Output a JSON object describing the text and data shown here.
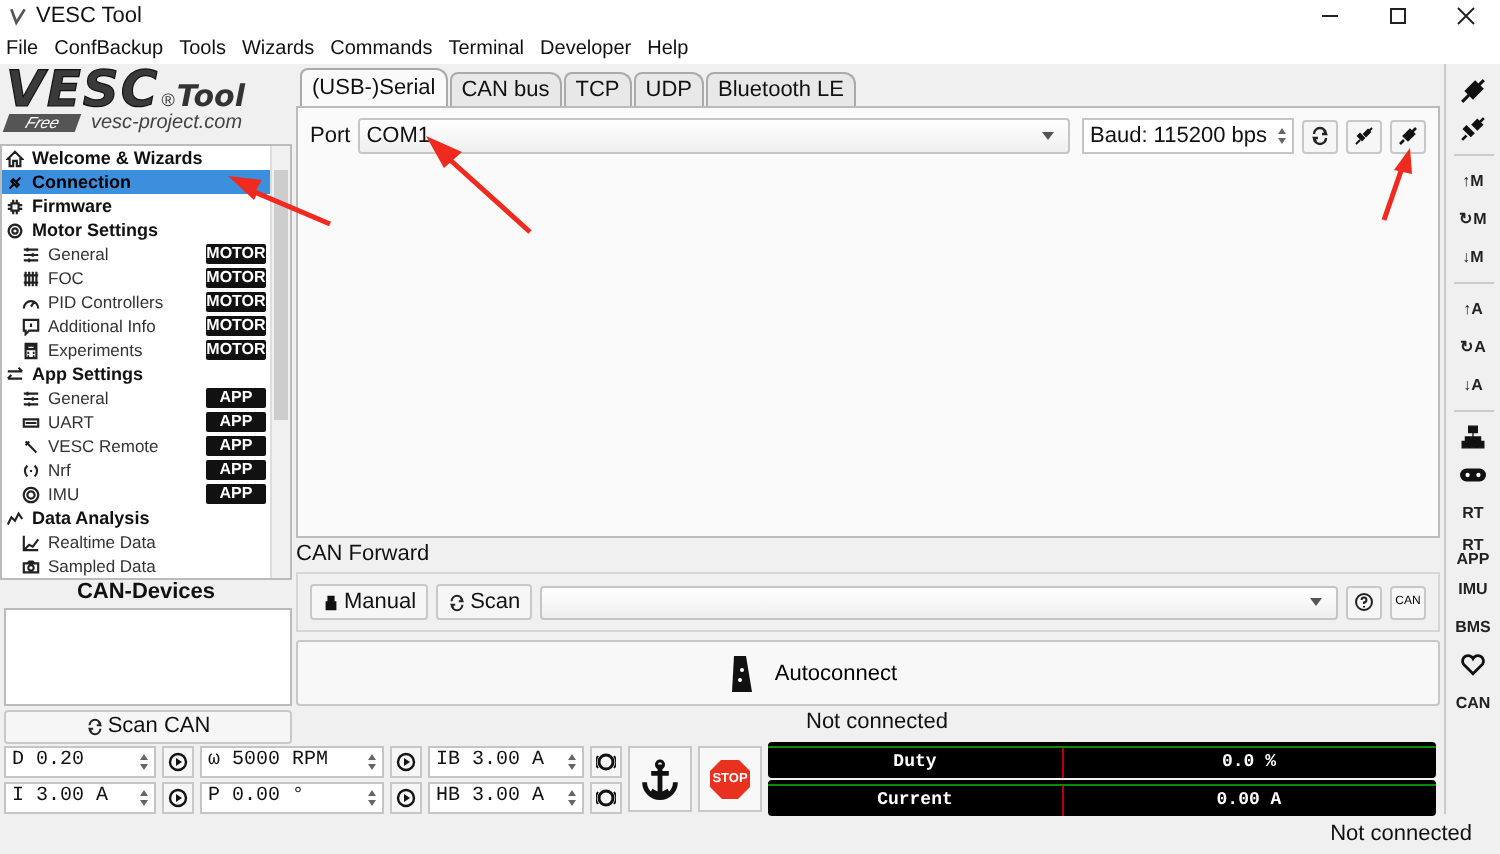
{
  "window": {
    "title": "VESC Tool"
  },
  "menu": [
    "File",
    "ConfBackup",
    "Tools",
    "Wizards",
    "Commands",
    "Terminal",
    "Developer",
    "Help"
  ],
  "logo": {
    "name": "VESC",
    "mark": "®",
    "product": "Tool",
    "edition": "Free",
    "url": "vesc-project.com"
  },
  "sidebar": {
    "items": [
      {
        "label": "Welcome & Wizards",
        "selected": false
      },
      {
        "label": "Connection",
        "selected": true
      },
      {
        "label": "Firmware",
        "selected": false
      },
      {
        "label": "Motor Settings",
        "selected": false,
        "children": [
          {
            "label": "General",
            "badge": "MOTOR",
            "selected": false
          },
          {
            "label": "FOC",
            "badge": "MOTOR",
            "selected": false
          },
          {
            "label": "PID Controllers",
            "badge": "MOTOR",
            "selected": false
          },
          {
            "label": "Additional Info",
            "badge": "MOTOR",
            "selected": false
          },
          {
            "label": "Experiments",
            "badge": "MOTOR",
            "selected": false
          }
        ]
      },
      {
        "label": "App Settings",
        "selected": false,
        "children": [
          {
            "label": "General",
            "badge": "APP",
            "selected": false
          },
          {
            "label": "UART",
            "badge": "APP",
            "selected": false
          },
          {
            "label": "VESC Remote",
            "badge": "APP",
            "selected": false
          },
          {
            "label": "Nrf",
            "badge": "APP",
            "selected": false
          },
          {
            "label": "IMU",
            "badge": "APP",
            "selected": false
          }
        ]
      },
      {
        "label": "Data Analysis",
        "selected": false,
        "children": [
          {
            "label": "Realtime Data",
            "selected": false
          },
          {
            "label": "Sampled Data",
            "selected": false
          }
        ]
      }
    ]
  },
  "can_devices": {
    "title": "CAN-Devices",
    "scan_button": "Scan CAN"
  },
  "tabs": [
    {
      "label": "(USB-)Serial",
      "selected": true
    },
    {
      "label": "CAN bus",
      "selected": false
    },
    {
      "label": "TCP",
      "selected": false
    },
    {
      "label": "UDP",
      "selected": false
    },
    {
      "label": "Bluetooth LE",
      "selected": false
    }
  ],
  "port": {
    "label": "Port",
    "value": "COM1",
    "baud": "Baud: 115200 bps"
  },
  "can_forward": {
    "title": "CAN Forward",
    "manual_button": "Manual",
    "scan_button": "Scan",
    "can_button": "CAN"
  },
  "autoconnect_button": "Autoconnect",
  "connection_status": "Not connected",
  "controls": [
    {
      "value": "D 0.20",
      "kind": "play"
    },
    {
      "value": "ω 5000 RPM",
      "kind": "play"
    },
    {
      "value": "IB 3.00 A",
      "kind": "brake"
    },
    {
      "value": "I 3.00 A",
      "kind": "play"
    },
    {
      "value": "P 0.00 °",
      "kind": "play"
    },
    {
      "value": "HB 3.00 A",
      "kind": "brake"
    }
  ],
  "stop_button": "STOP",
  "gauges": [
    {
      "label": "Duty",
      "reading": "0.0 %"
    },
    {
      "label": "Current",
      "reading": "0.00 A"
    }
  ],
  "toolbar": [
    [
      {
        "kind": "connect"
      },
      {
        "kind": "disconnect"
      }
    ],
    [
      {
        "kind": "text",
        "label": "↑M"
      },
      {
        "kind": "text",
        "label": "↻M"
      },
      {
        "kind": "text",
        "label": "↓M"
      }
    ],
    [
      {
        "kind": "text",
        "label": "↑A"
      },
      {
        "kind": "text",
        "label": "↻A"
      },
      {
        "kind": "text",
        "label": "↓A"
      }
    ],
    [
      {
        "kind": "network"
      },
      {
        "kind": "gamepad"
      },
      {
        "kind": "text",
        "label": "RT"
      },
      {
        "kind": "text",
        "label": "RT APP"
      },
      {
        "kind": "text",
        "label": "IMU"
      },
      {
        "kind": "text",
        "label": "BMS"
      },
      {
        "kind": "heart"
      },
      {
        "kind": "text",
        "label": "CAN"
      }
    ]
  ],
  "status_bar": "Not connected"
}
